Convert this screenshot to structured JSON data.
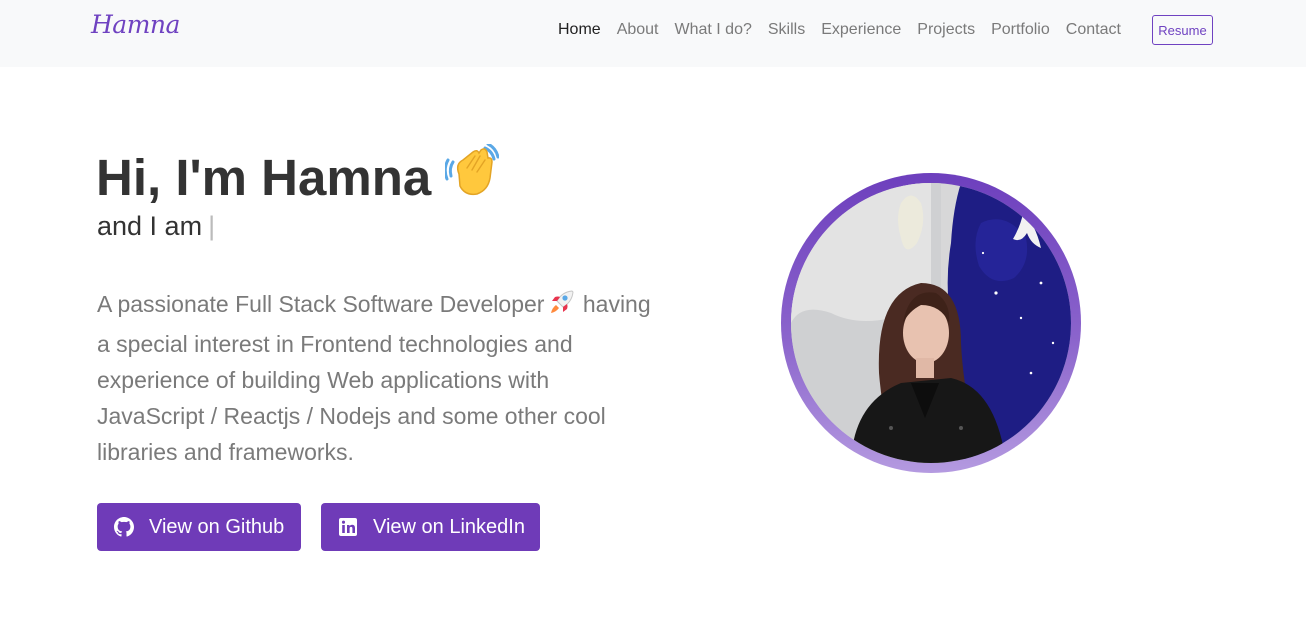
{
  "nav": {
    "brand": "Hamna",
    "links": [
      "Home",
      "About",
      "What I do?",
      "Skills",
      "Experience",
      "Projects",
      "Portfolio",
      "Contact"
    ],
    "active": "Home",
    "resume_label": "Resume"
  },
  "hero": {
    "greeting": "Hi, I'm Hamna",
    "wave_icon": "waving-hand-emoji",
    "subtitle": "and I am",
    "cursor": "|",
    "bio": "A passionate Full Stack Software Developer",
    "rocket_icon": "rocket-emoji",
    "bio_rest": "having a special interest in Frontend technologies and experience of building Web applications with JavaScript / Reactjs / Nodejs and some other cool libraries and frameworks.",
    "github_label": "View on Github",
    "github_icon": "github-icon",
    "linkedin_label": "View on LinkedIn",
    "linkedin_icon": "linkedin-icon"
  },
  "colors": {
    "accent": "#6f42c1",
    "button": "#6f3bb8",
    "nav_bg": "#f8f9fa",
    "muted_text": "#7a7a7a"
  }
}
